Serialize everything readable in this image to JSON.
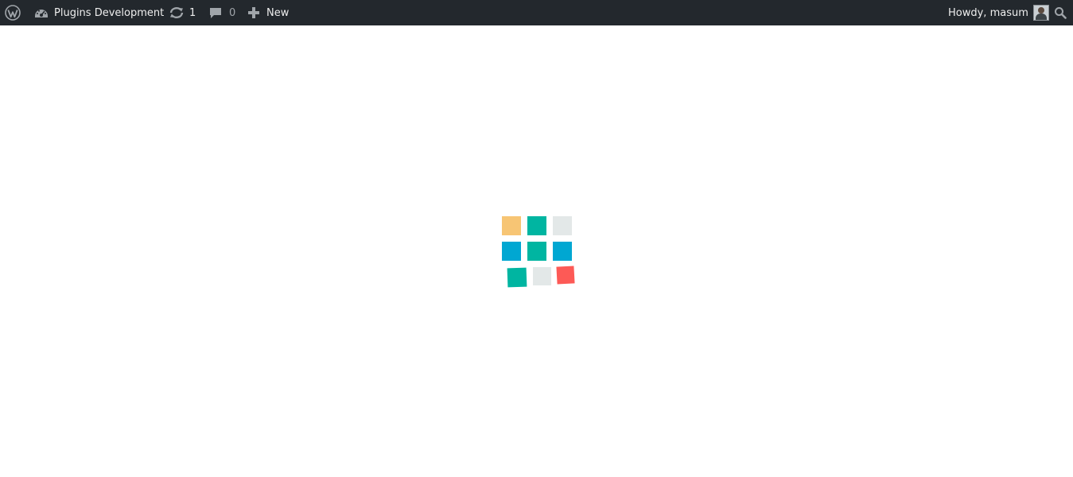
{
  "adminbar": {
    "wp_logo_icon": "wordpress-logo-icon",
    "site_icon": "dashboard-icon",
    "site_name": "Plugins Development",
    "updates_icon": "updates-icon",
    "updates_count": "1",
    "comments_icon": "comment-bubble-icon",
    "comments_count": "0",
    "new_icon": "plus-icon",
    "new_label": "New",
    "howdy": "Howdy, masum",
    "avatar": "user-avatar",
    "search_icon": "search-icon"
  },
  "loader": {
    "tiles": [
      {
        "color": "#f7c574"
      },
      {
        "color": "#00b5a1"
      },
      {
        "color": "#e3e8e8"
      },
      {
        "color": "#00a7d2"
      },
      {
        "color": "#00b5a1"
      },
      {
        "color": "#00a7d2"
      },
      {
        "color": "#00b5a1"
      },
      {
        "color": "#e3e8e8"
      },
      {
        "color": "#fd5a56"
      }
    ]
  },
  "colors": {
    "adminbar_bg": "#23282d",
    "adminbar_text": "#eeeeee",
    "page_bg": "#ffffff"
  }
}
